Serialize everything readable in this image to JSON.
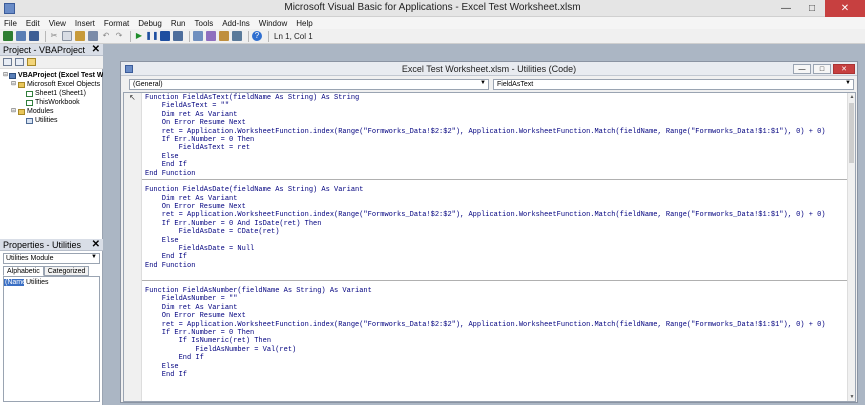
{
  "window": {
    "title": "Microsoft Visual Basic for Applications - Excel Test Worksheet.xlsm",
    "minimize": "—",
    "maximize": "□",
    "close": "✕"
  },
  "menu": [
    "File",
    "Edit",
    "View",
    "Insert",
    "Format",
    "Debug",
    "Run",
    "Tools",
    "Add-Ins",
    "Window",
    "Help"
  ],
  "toolbar": {
    "status": "Ln 1, Col 1"
  },
  "project": {
    "title": "Project - VBAProject",
    "close": "✕",
    "tree": [
      {
        "level": 0,
        "expander": "⊟",
        "icon": "project-icon",
        "label": "VBAProject (Excel Test Worksheet.xlsm)"
      },
      {
        "level": 1,
        "expander": "⊟",
        "icon": "folder-icon",
        "label": "Microsoft Excel Objects"
      },
      {
        "level": 2,
        "expander": "",
        "icon": "sheet-icon",
        "label": "Sheet1 (Sheet1)"
      },
      {
        "level": 2,
        "expander": "",
        "icon": "sheet-icon",
        "label": "ThisWorkbook"
      },
      {
        "level": 1,
        "expander": "⊟",
        "icon": "folder-icon",
        "label": "Modules"
      },
      {
        "level": 2,
        "expander": "",
        "icon": "module-icon",
        "label": "Utilities"
      }
    ]
  },
  "properties": {
    "title": "Properties - Utilities",
    "close": "✕",
    "object": "Utilities Module",
    "tabs": [
      "Alphabetic",
      "Categorized"
    ],
    "rows": [
      {
        "key": "(Name)",
        "value": "Utilities"
      }
    ]
  },
  "code_window": {
    "title": "Excel Test Worksheet.xlsm - Utilities (Code)",
    "min": "—",
    "max": "□",
    "close": "✕",
    "object_combo": "(General)",
    "proc_combo": "FieldAsText",
    "lines": [
      "Function FieldAsText(fieldName As String) As String",
      "    FieldAsText = \"\"",
      "    Dim ret As Variant",
      "    On Error Resume Next",
      "    ret = Application.WorksheetFunction.index(Range(\"Formworks_Data!$2:$2\"), Application.WorksheetFunction.Match(fieldName, Range(\"Formworks_Data!$1:$1\"), 0) + 0)",
      "    If Err.Number = 0 Then",
      "        FieldAsText = ret",
      "    Else",
      "    End If",
      "End Function",
      "",
      "Function FieldAsDate(fieldName As String) As Variant",
      "    Dim ret As Variant",
      "    On Error Resume Next",
      "    ret = Application.WorksheetFunction.index(Range(\"Formworks_Data!$2:$2\"), Application.WorksheetFunction.Match(fieldName, Range(\"Formworks_Data!$1:$1\"), 0) + 0)",
      "    If Err.Number = 0 And IsDate(ret) Then",
      "        FieldAsDate = CDate(ret)",
      "    Else",
      "        FieldAsDate = Null",
      "    End If",
      "End Function",
      "",
      "",
      "Function FieldAsNumber(fieldName As String) As Variant",
      "    FieldAsNumber = \"\"",
      "    Dim ret As Variant",
      "    On Error Resume Next",
      "    ret = Application.WorksheetFunction.index(Range(\"Formworks_Data!$2:$2\"), Application.WorksheetFunction.Match(fieldName, Range(\"Formworks_Data!$1:$1\"), 0) + 0)",
      "    If Err.Number = 0 Then",
      "        If IsNumeric(ret) Then",
      "            FieldAsNumber = Val(ret)",
      "        End If",
      "    Else",
      "    End If"
    ]
  }
}
